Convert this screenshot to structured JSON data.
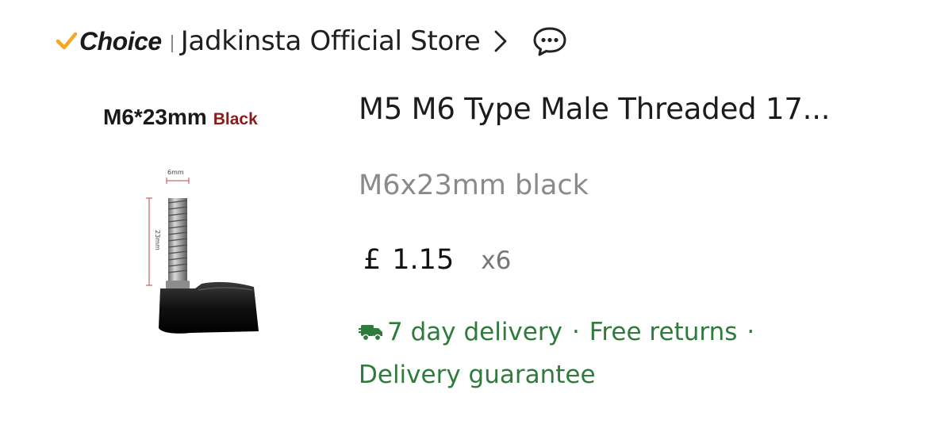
{
  "store": {
    "choice_label": "Choice",
    "name": "Jadkinsta Official Store"
  },
  "image": {
    "size_label": "M6*23mm",
    "color_label": "Black",
    "dimension_top": "6mm",
    "dimension_side": "23mm"
  },
  "product": {
    "title": "M5 M6 Type Male Threaded 17...",
    "variant": "M6x23mm black",
    "currency": "£",
    "price": "1.15",
    "quantity": "x6"
  },
  "delivery": {
    "days": "7 day delivery",
    "separator": "·",
    "returns": "Free returns",
    "guarantee": "Delivery guarantee"
  },
  "colors": {
    "choice_check": "#f5a623",
    "delivery_green": "#2f7a3d",
    "black_label": "#8b1a1a"
  },
  "icons": [
    "check-icon",
    "chevron-right-icon",
    "chat-icon",
    "truck-icon"
  ]
}
